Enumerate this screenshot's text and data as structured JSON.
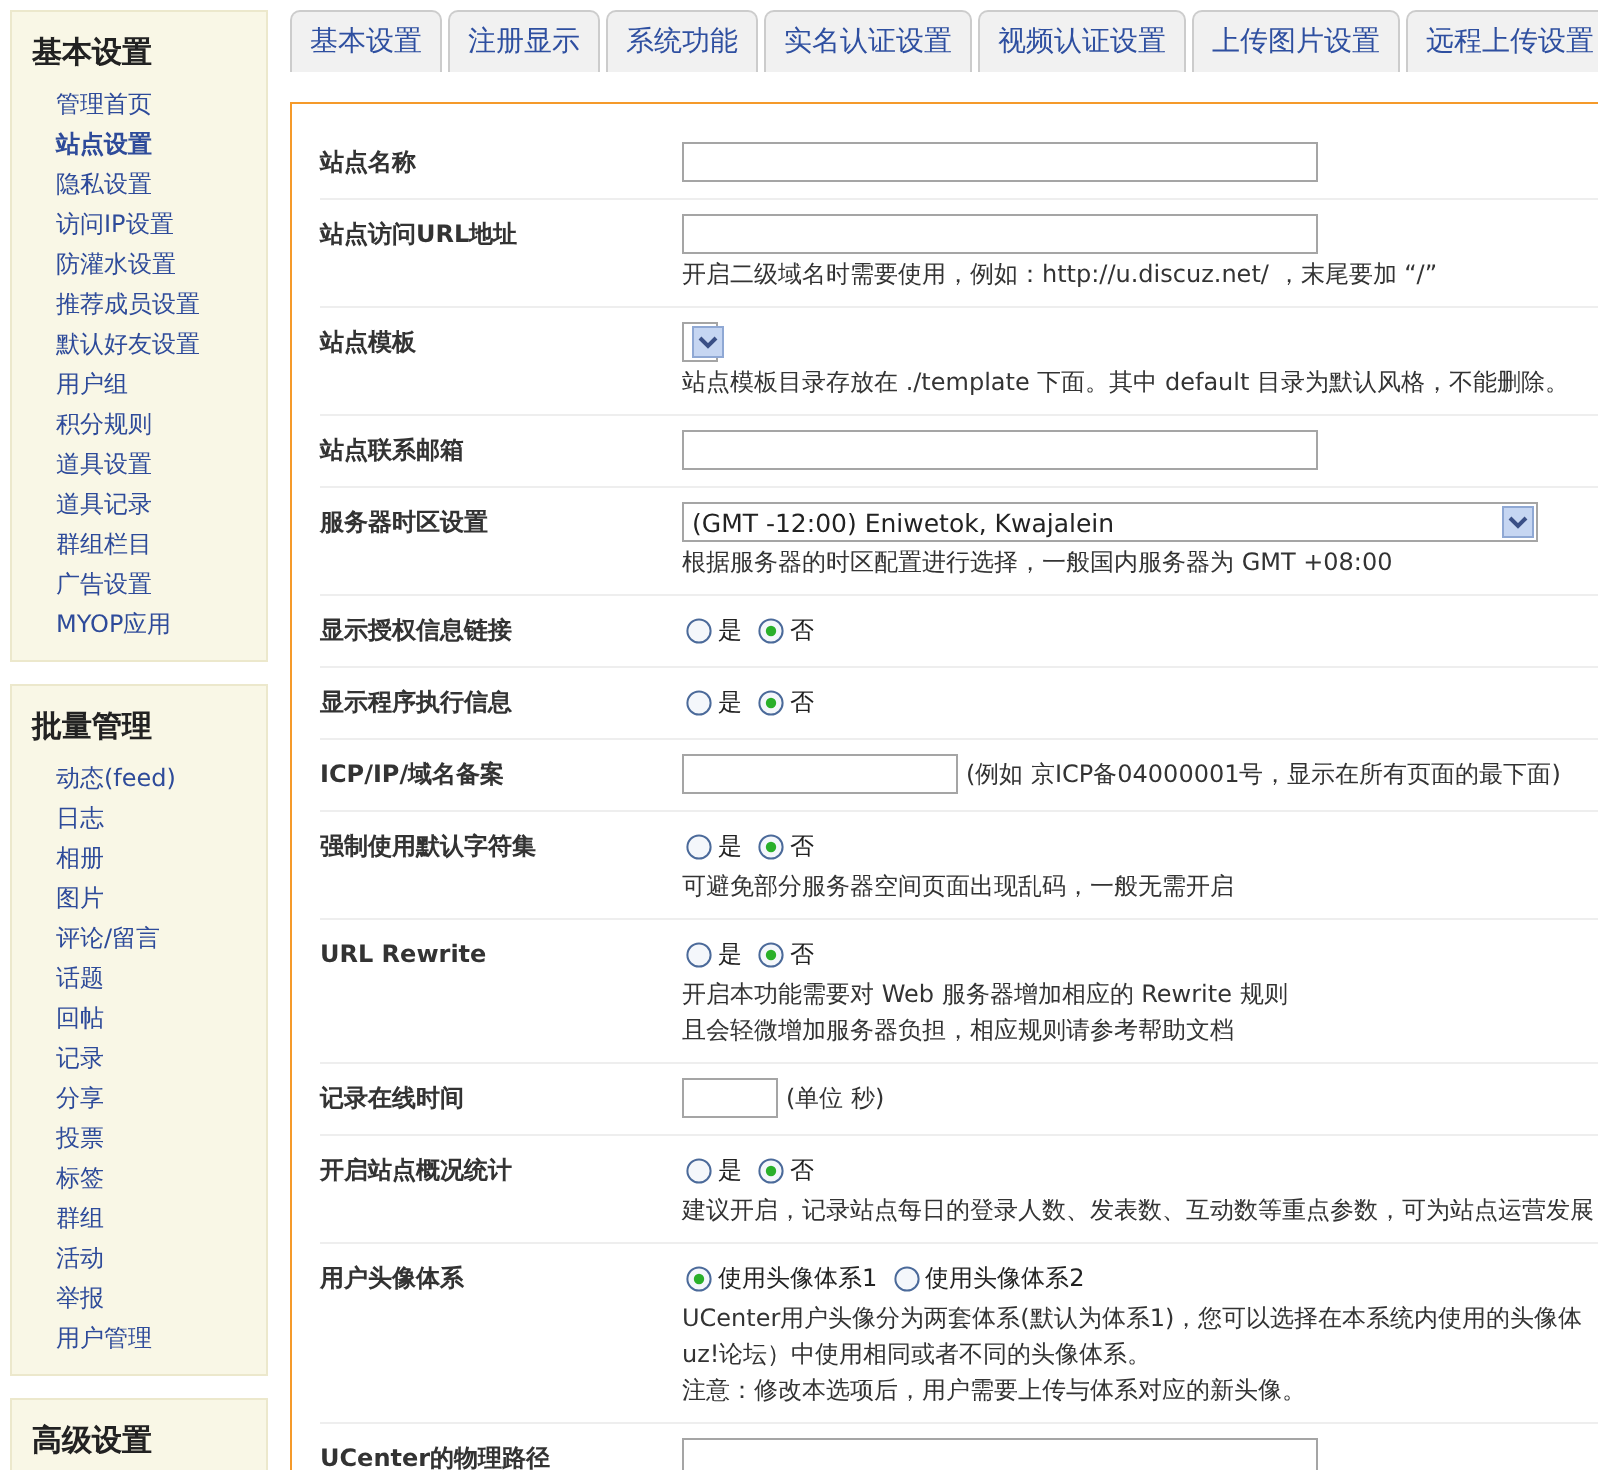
{
  "sidebar": [
    {
      "title": "基本设置",
      "items": [
        {
          "label": "管理首页",
          "selected": false
        },
        {
          "label": "站点设置",
          "selected": true
        },
        {
          "label": "隐私设置",
          "selected": false
        },
        {
          "label": "访问IP设置",
          "selected": false
        },
        {
          "label": "防灌水设置",
          "selected": false
        },
        {
          "label": "推荐成员设置",
          "selected": false
        },
        {
          "label": "默认好友设置",
          "selected": false
        },
        {
          "label": "用户组",
          "selected": false
        },
        {
          "label": "积分规则",
          "selected": false
        },
        {
          "label": "道具设置",
          "selected": false
        },
        {
          "label": "道具记录",
          "selected": false
        },
        {
          "label": "群组栏目",
          "selected": false
        },
        {
          "label": "广告设置",
          "selected": false
        },
        {
          "label": "MYOP应用",
          "selected": false
        }
      ]
    },
    {
      "title": "批量管理",
      "items": [
        {
          "label": "动态(feed)",
          "selected": false
        },
        {
          "label": "日志",
          "selected": false
        },
        {
          "label": "相册",
          "selected": false
        },
        {
          "label": "图片",
          "selected": false
        },
        {
          "label": "评论/留言",
          "selected": false
        },
        {
          "label": "话题",
          "selected": false
        },
        {
          "label": "回帖",
          "selected": false
        },
        {
          "label": "记录",
          "selected": false
        },
        {
          "label": "分享",
          "selected": false
        },
        {
          "label": "投票",
          "selected": false
        },
        {
          "label": "标签",
          "selected": false
        },
        {
          "label": "群组",
          "selected": false
        },
        {
          "label": "活动",
          "selected": false
        },
        {
          "label": "举报",
          "selected": false
        },
        {
          "label": "用户管理",
          "selected": false
        }
      ]
    },
    {
      "title": "高级设置"
    }
  ],
  "tabs": [
    {
      "label": "基本设置"
    },
    {
      "label": "注册显示"
    },
    {
      "label": "系统功能"
    },
    {
      "label": "实名认证设置"
    },
    {
      "label": "视频认证设置"
    },
    {
      "label": "上传图片设置"
    },
    {
      "label": "远程上传设置"
    }
  ],
  "rows": [
    {
      "label": "站点名称",
      "kind": "input"
    },
    {
      "label": "站点访问URL地址",
      "kind": "input",
      "notes": [
        "开启二级域名时需要使用，例如：http://u.discuz.net/ ，末尾要加 “/”"
      ]
    },
    {
      "label": "站点模板",
      "kind": "select",
      "notes": [
        "站点模板目录存放在 ./template 下面。其中 default 目录为默认风格，不能删除。"
      ]
    },
    {
      "label": "站点联系邮箱",
      "kind": "input"
    },
    {
      "label": "服务器时区设置",
      "kind": "select",
      "value": "(GMT -12:00) Eniwetok, Kwajalein",
      "notes": [
        "根据服务器的时区配置进行选择，一般国内服务器为 GMT +08:00"
      ]
    },
    {
      "label": "显示授权信息链接",
      "kind": "radio",
      "options": [
        {
          "label": "是",
          "selected": false
        },
        {
          "label": "否",
          "selected": true
        }
      ]
    },
    {
      "label": "显示程序执行信息",
      "kind": "radio",
      "options": [
        {
          "label": "是",
          "selected": false
        },
        {
          "label": "否",
          "selected": true
        }
      ]
    },
    {
      "label": "ICP/IP/域名备案",
      "kind": "shortinput",
      "suffix": "(例如 京ICP备04000001号，显示在所有页面的最下面)"
    },
    {
      "label": "强制使用默认字符集",
      "kind": "radio",
      "options": [
        {
          "label": "是",
          "selected": false
        },
        {
          "label": "否",
          "selected": true
        }
      ],
      "notes": [
        "可避免部分服务器空间页面出现乱码，一般无需开启"
      ]
    },
    {
      "label": "URL Rewrite",
      "kind": "radio",
      "options": [
        {
          "label": "是",
          "selected": false
        },
        {
          "label": "否",
          "selected": true
        }
      ],
      "notes": [
        "开启本功能需要对 Web 服务器增加相应的 Rewrite 规则",
        "且会轻微增加服务器负担，相应规则请参考帮助文档"
      ]
    },
    {
      "label": "记录在线时间",
      "kind": "tinyinput",
      "suffix": "(单位 秒)"
    },
    {
      "label": "开启站点概况统计",
      "kind": "radio",
      "options": [
        {
          "label": "是",
          "selected": false
        },
        {
          "label": "否",
          "selected": true
        }
      ],
      "notes": [
        "建议开启，记录站点每日的登录人数、发表数、互动数等重点参数，可为站点运营发展"
      ]
    },
    {
      "label": "用户头像体系",
      "kind": "radio",
      "options": [
        {
          "label": "使用头像体系1",
          "selected": true
        },
        {
          "label": "使用头像体系2",
          "selected": false
        }
      ],
      "notes": [
        "UCenter用户头像分为两套体系(默认为体系1)，您可以选择在本系统内使用的头像体",
        "uz!论坛）中使用相同或者不同的头像体系。",
        "注意：修改本选项后，用户需要上传与体系对应的新头像。"
      ]
    },
    {
      "label": "UCenter的物理路径",
      "kind": "input"
    }
  ]
}
